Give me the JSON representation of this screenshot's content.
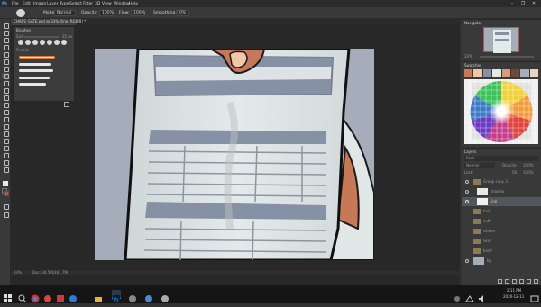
{
  "menu": [
    "Ps",
    "File",
    "Edit",
    "Image",
    "Layer",
    "Type",
    "Select",
    "Filter",
    "3D",
    "View",
    "Window",
    "Help"
  ],
  "window_controls": [
    "–",
    "❐",
    "✕"
  ],
  "options": {
    "mode_label": "Mode:",
    "mode_value": "Normal",
    "opacity_label": "Opacity:",
    "opacity_value": "100%",
    "flow_label": "Flow:",
    "flow_value": "100%",
    "smoothing_label": "Smoothing:",
    "smoothing_value": "0%"
  },
  "document": {
    "tab_title": "CHARS_GATE.psd @ 33% (line, RGB/8) *",
    "zoom_status": "33%",
    "doc_status": "Doc: 34.5M/361.7M"
  },
  "brushes_panel": {
    "title": "Brushes",
    "size_label": "Size:",
    "size_value": "35 px",
    "group_label": "Pencils"
  },
  "navigator": {
    "title": "Navigator",
    "zoom": "33%"
  },
  "swatches": {
    "title": "Swatches"
  },
  "layers_panel": {
    "title": "Layers",
    "filter_label": "Kind",
    "blend_mode": "Normal",
    "opacity_label": "Opacity:",
    "opacity_value": "100%",
    "fill_label": "Fill:",
    "fill_value": "100%",
    "lock_label": "Lock:",
    "layers": [
      "Group copy 3",
      "shadow",
      "line",
      "hair",
      "cuff",
      "sleeve",
      "Skin",
      "body",
      "bg"
    ]
  },
  "taskbar": {
    "time": "2:11 PM",
    "date": "2020-12-11"
  },
  "colors": {
    "foreground": "#e8e8e8",
    "background": "#c0504d",
    "accent": "#1c97ea"
  }
}
